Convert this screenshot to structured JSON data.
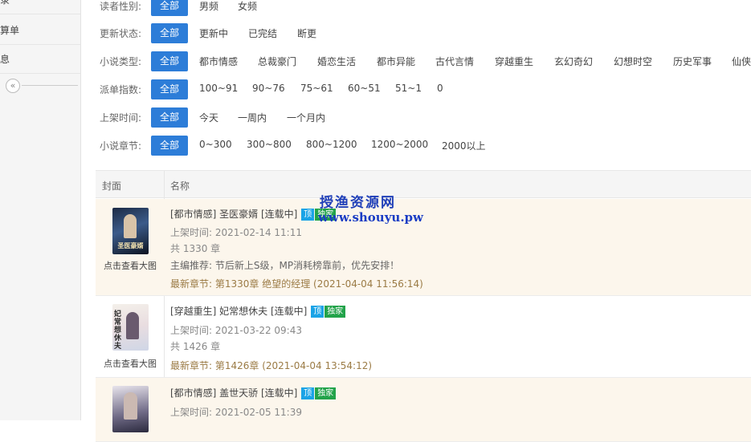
{
  "sidebar": {
    "items": [
      {
        "label": "记录"
      },
      {
        "label": "结算单"
      },
      {
        "label": "信息"
      }
    ],
    "collapse_icon": "«"
  },
  "filters": {
    "gender": {
      "label": "读者性别:",
      "options": [
        "全部",
        "男频",
        "女频"
      ]
    },
    "status": {
      "label": "更新状态:",
      "options": [
        "全部",
        "更新中",
        "已完结",
        "断更"
      ]
    },
    "type": {
      "label": "小说类型:",
      "options": [
        "全部",
        "都市情感",
        "总裁豪门",
        "婚恋生活",
        "都市异能",
        "古代言情",
        "穿越重生",
        "玄幻奇幻",
        "幻想时空",
        "历史军事",
        "仙侠"
      ]
    },
    "index": {
      "label": "派单指数:",
      "options": [
        "全部",
        "100~91",
        "90~76",
        "75~61",
        "60~51",
        "51~1",
        "0"
      ]
    },
    "time": {
      "label": "上架时间:",
      "options": [
        "全部",
        "今天",
        "一周内",
        "一个月内"
      ]
    },
    "chapters": {
      "label": "小说章节:",
      "options": [
        "全部",
        "0~300",
        "300~800",
        "800~1200",
        "1200~2000",
        "2000以上"
      ]
    }
  },
  "table": {
    "headers": {
      "cover": "封面",
      "name": "名称"
    },
    "rows": [
      {
        "title": "[都市情感] 圣医豪婿 [连载中]",
        "badge_top": "顶",
        "badge_excl": "独家",
        "listed": "上架时间: 2021-02-14 11:11",
        "chapters": "共 1330 章",
        "recommend": "主编推荐: 节后新上S级，MP消耗榜靠前，优先安排！",
        "latest": "最新章节: 第1330章 绝望的经理 (2021-04-04 11:56:14)",
        "cover_caption": "点击查看大图",
        "cover_text": "圣医豪婿"
      },
      {
        "title": "[穿越重生] 妃常想休夫 [连载中]",
        "badge_top": "顶",
        "badge_excl": "独家",
        "listed": "上架时间: 2021-03-22 09:43",
        "chapters": "共 1426 章",
        "latest": "最新章节: 第1426章 (2021-04-04 13:54:12)",
        "cover_caption": "点击查看大图",
        "cover_text": "妃常想休夫"
      },
      {
        "title": "[都市情感] 盖世天骄 [连载中]",
        "badge_top": "顶",
        "badge_excl": "独家",
        "listed": "上架时间: 2021-02-05 11:39"
      }
    ]
  },
  "watermark": {
    "line1": "授渔资源网",
    "line2": "www.shouyu.pw"
  },
  "colors": {
    "primary": "#2d7dd8",
    "badge_top": "#1aa3e6",
    "badge_exclusive": "#22a34a",
    "highlight_row": "#fcf6ec",
    "latest_text": "#9b7b45"
  }
}
